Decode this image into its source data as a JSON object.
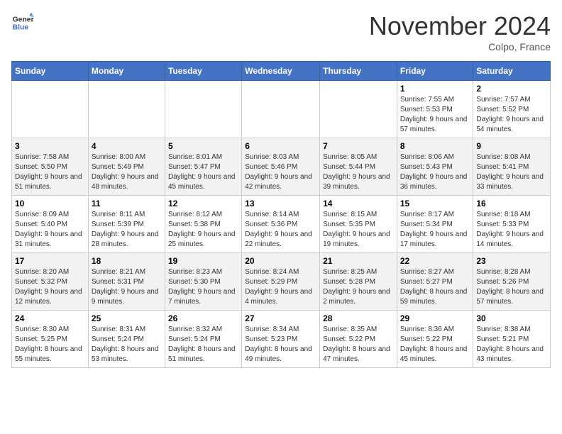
{
  "header": {
    "logo_line1": "General",
    "logo_line2": "Blue",
    "month": "November 2024",
    "location": "Colpo, France"
  },
  "weekdays": [
    "Sunday",
    "Monday",
    "Tuesday",
    "Wednesday",
    "Thursday",
    "Friday",
    "Saturday"
  ],
  "weeks": [
    [
      {
        "day": "",
        "info": ""
      },
      {
        "day": "",
        "info": ""
      },
      {
        "day": "",
        "info": ""
      },
      {
        "day": "",
        "info": ""
      },
      {
        "day": "",
        "info": ""
      },
      {
        "day": "1",
        "info": "Sunrise: 7:55 AM\nSunset: 5:53 PM\nDaylight: 9 hours and 57 minutes."
      },
      {
        "day": "2",
        "info": "Sunrise: 7:57 AM\nSunset: 5:52 PM\nDaylight: 9 hours and 54 minutes."
      }
    ],
    [
      {
        "day": "3",
        "info": "Sunrise: 7:58 AM\nSunset: 5:50 PM\nDaylight: 9 hours and 51 minutes."
      },
      {
        "day": "4",
        "info": "Sunrise: 8:00 AM\nSunset: 5:49 PM\nDaylight: 9 hours and 48 minutes."
      },
      {
        "day": "5",
        "info": "Sunrise: 8:01 AM\nSunset: 5:47 PM\nDaylight: 9 hours and 45 minutes."
      },
      {
        "day": "6",
        "info": "Sunrise: 8:03 AM\nSunset: 5:46 PM\nDaylight: 9 hours and 42 minutes."
      },
      {
        "day": "7",
        "info": "Sunrise: 8:05 AM\nSunset: 5:44 PM\nDaylight: 9 hours and 39 minutes."
      },
      {
        "day": "8",
        "info": "Sunrise: 8:06 AM\nSunset: 5:43 PM\nDaylight: 9 hours and 36 minutes."
      },
      {
        "day": "9",
        "info": "Sunrise: 8:08 AM\nSunset: 5:41 PM\nDaylight: 9 hours and 33 minutes."
      }
    ],
    [
      {
        "day": "10",
        "info": "Sunrise: 8:09 AM\nSunset: 5:40 PM\nDaylight: 9 hours and 31 minutes."
      },
      {
        "day": "11",
        "info": "Sunrise: 8:11 AM\nSunset: 5:39 PM\nDaylight: 9 hours and 28 minutes."
      },
      {
        "day": "12",
        "info": "Sunrise: 8:12 AM\nSunset: 5:38 PM\nDaylight: 9 hours and 25 minutes."
      },
      {
        "day": "13",
        "info": "Sunrise: 8:14 AM\nSunset: 5:36 PM\nDaylight: 9 hours and 22 minutes."
      },
      {
        "day": "14",
        "info": "Sunrise: 8:15 AM\nSunset: 5:35 PM\nDaylight: 9 hours and 19 minutes."
      },
      {
        "day": "15",
        "info": "Sunrise: 8:17 AM\nSunset: 5:34 PM\nDaylight: 9 hours and 17 minutes."
      },
      {
        "day": "16",
        "info": "Sunrise: 8:18 AM\nSunset: 5:33 PM\nDaylight: 9 hours and 14 minutes."
      }
    ],
    [
      {
        "day": "17",
        "info": "Sunrise: 8:20 AM\nSunset: 5:32 PM\nDaylight: 9 hours and 12 minutes."
      },
      {
        "day": "18",
        "info": "Sunrise: 8:21 AM\nSunset: 5:31 PM\nDaylight: 9 hours and 9 minutes."
      },
      {
        "day": "19",
        "info": "Sunrise: 8:23 AM\nSunset: 5:30 PM\nDaylight: 9 hours and 7 minutes."
      },
      {
        "day": "20",
        "info": "Sunrise: 8:24 AM\nSunset: 5:29 PM\nDaylight: 9 hours and 4 minutes."
      },
      {
        "day": "21",
        "info": "Sunrise: 8:25 AM\nSunset: 5:28 PM\nDaylight: 9 hours and 2 minutes."
      },
      {
        "day": "22",
        "info": "Sunrise: 8:27 AM\nSunset: 5:27 PM\nDaylight: 8 hours and 59 minutes."
      },
      {
        "day": "23",
        "info": "Sunrise: 8:28 AM\nSunset: 5:26 PM\nDaylight: 8 hours and 57 minutes."
      }
    ],
    [
      {
        "day": "24",
        "info": "Sunrise: 8:30 AM\nSunset: 5:25 PM\nDaylight: 8 hours and 55 minutes."
      },
      {
        "day": "25",
        "info": "Sunrise: 8:31 AM\nSunset: 5:24 PM\nDaylight: 8 hours and 53 minutes."
      },
      {
        "day": "26",
        "info": "Sunrise: 8:32 AM\nSunset: 5:24 PM\nDaylight: 8 hours and 51 minutes."
      },
      {
        "day": "27",
        "info": "Sunrise: 8:34 AM\nSunset: 5:23 PM\nDaylight: 8 hours and 49 minutes."
      },
      {
        "day": "28",
        "info": "Sunrise: 8:35 AM\nSunset: 5:22 PM\nDaylight: 8 hours and 47 minutes."
      },
      {
        "day": "29",
        "info": "Sunrise: 8:36 AM\nSunset: 5:22 PM\nDaylight: 8 hours and 45 minutes."
      },
      {
        "day": "30",
        "info": "Sunrise: 8:38 AM\nSunset: 5:21 PM\nDaylight: 8 hours and 43 minutes."
      }
    ]
  ]
}
